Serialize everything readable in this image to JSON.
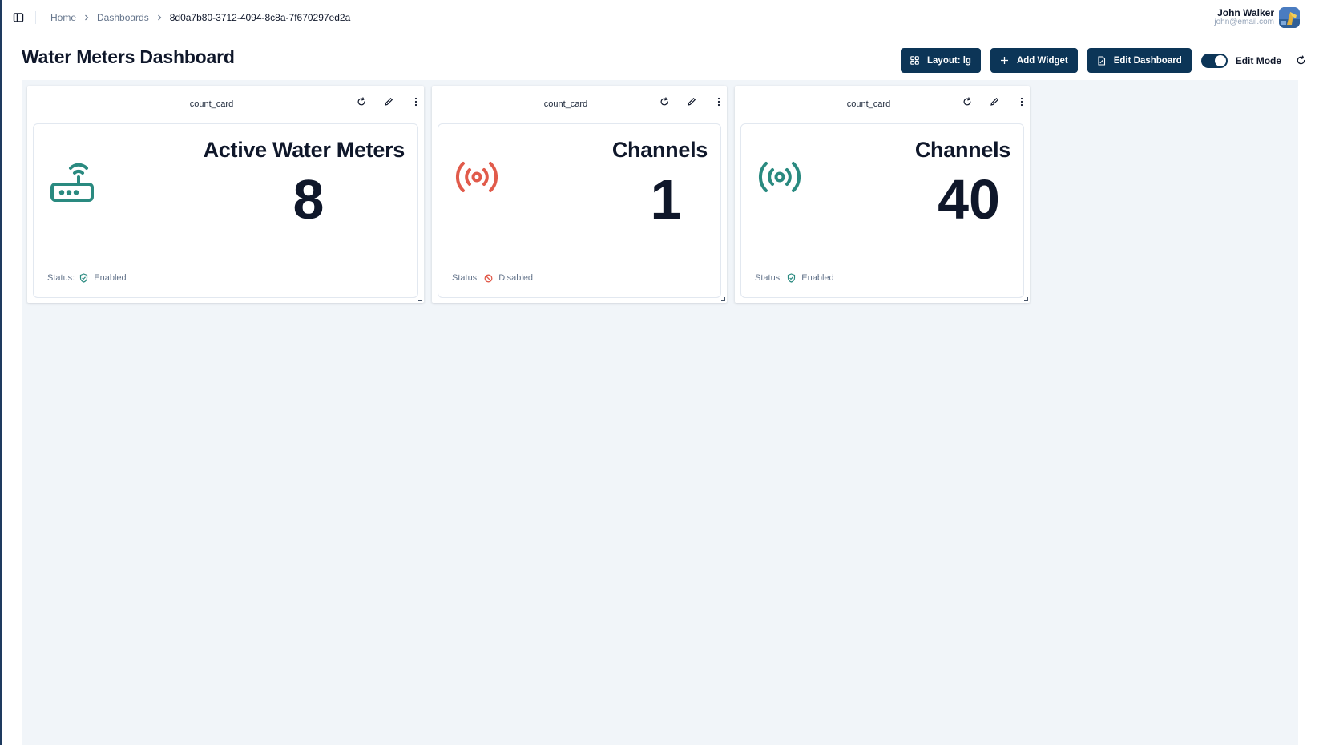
{
  "breadcrumb": {
    "items": [
      {
        "label": "Home"
      },
      {
        "label": "Dashboards"
      },
      {
        "label": "8d0a7b80-3712-4094-8c8a-7f670297ed2a"
      }
    ]
  },
  "user": {
    "name": "John Walker",
    "email": "john@email.com"
  },
  "page": {
    "title": "Water Meters Dashboard"
  },
  "toolbar": {
    "layout_label": "Layout: lg",
    "add_widget_label": "Add Widget",
    "edit_dashboard_label": "Edit Dashboard",
    "edit_mode_label": "Edit Mode",
    "edit_mode_on": true
  },
  "colors": {
    "primary": "#0c3557",
    "enabled": "#2a8a80",
    "disabled": "#e15b4b"
  },
  "widgets": [
    {
      "title": "count_card",
      "label": "Active Water Meters",
      "value": "8",
      "icon": "router-icon",
      "status_label": "Status:",
      "status": "Enabled"
    },
    {
      "title": "count_card",
      "label": "Channels",
      "value": "1",
      "icon": "broadcast-icon",
      "status_label": "Status:",
      "status": "Disabled"
    },
    {
      "title": "count_card",
      "label": "Channels",
      "value": "40",
      "icon": "broadcast-icon",
      "status_label": "Status:",
      "status": "Enabled"
    }
  ]
}
